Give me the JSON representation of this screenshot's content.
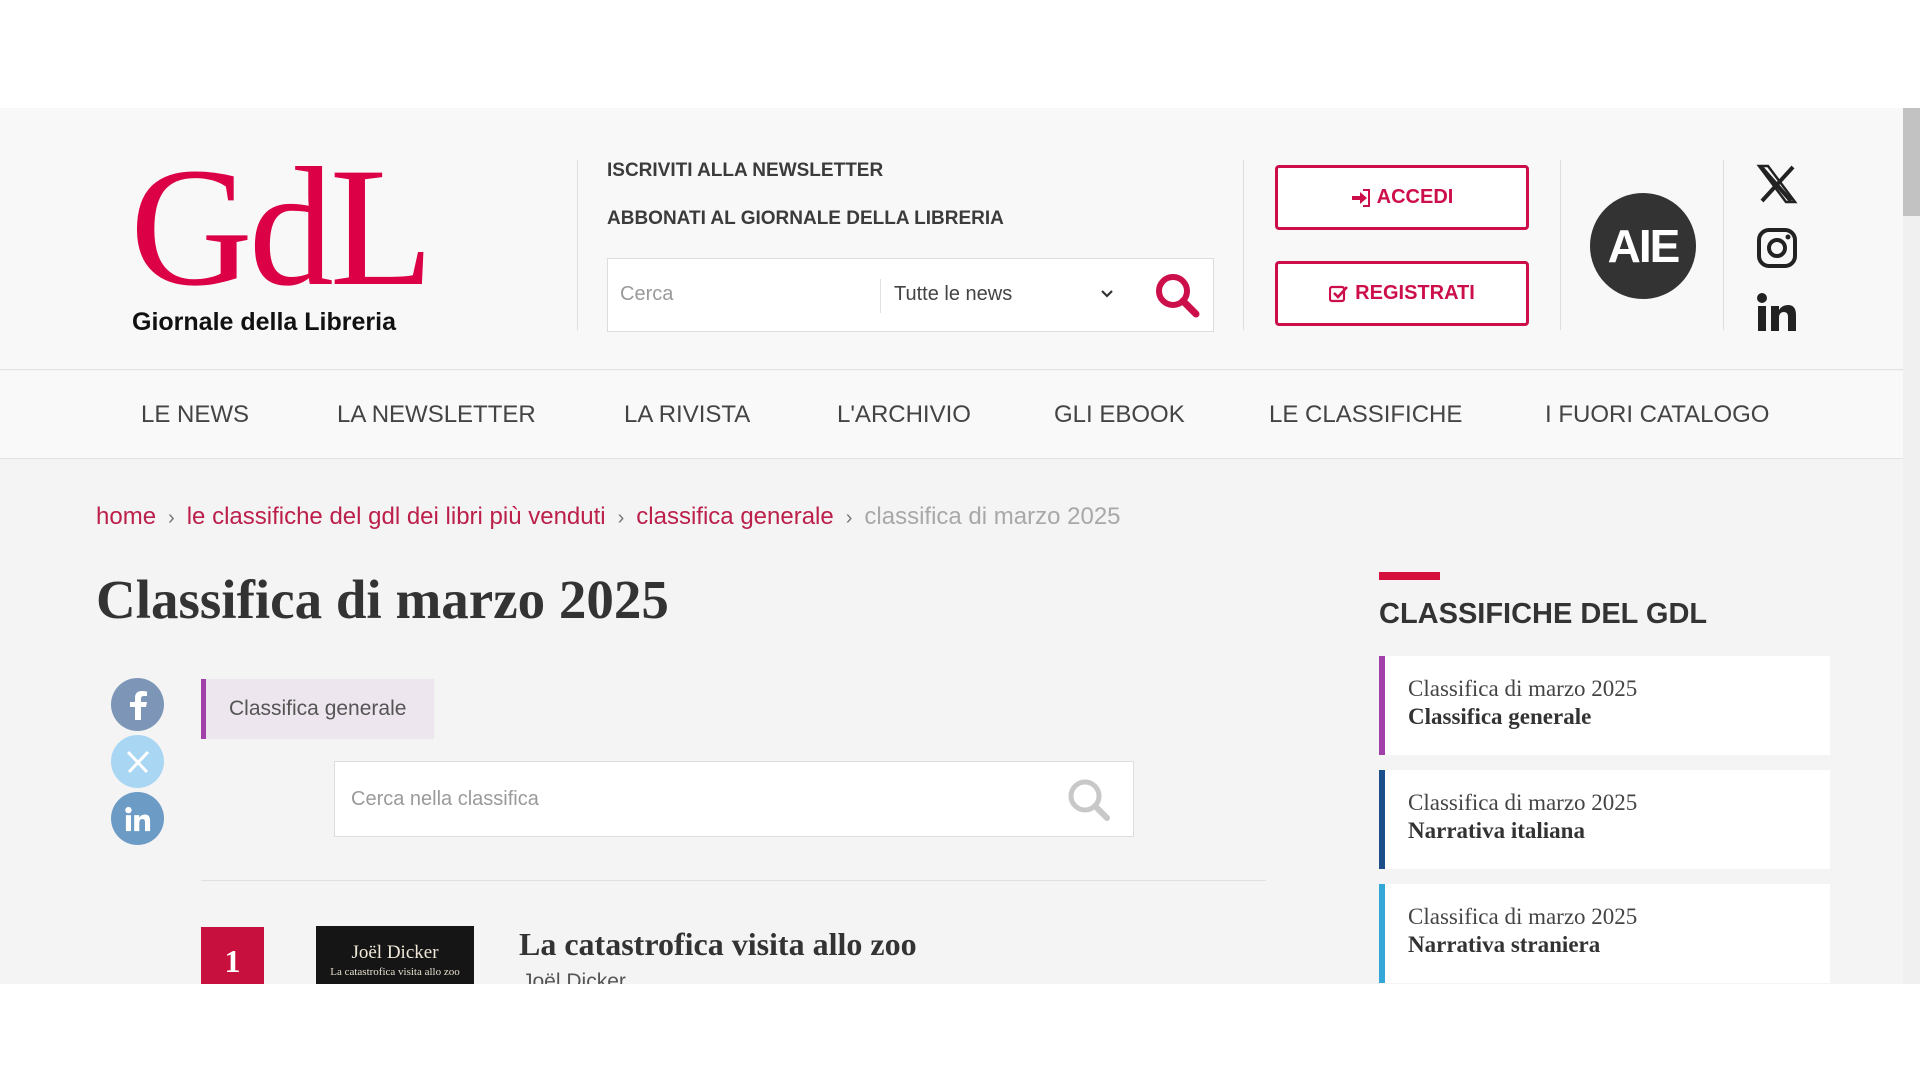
{
  "site": {
    "logo_letters": "GdL",
    "logo_tagline": "Giornale della Libreria",
    "aie_label": "AIE"
  },
  "header": {
    "links": [
      "ISCRIVITI ALLA NEWSLETTER",
      "ABBONATI AL GIORNALE DELLA LIBRERIA"
    ],
    "search": {
      "placeholder": "Cerca",
      "filter_selected": "Tutte le news"
    },
    "accedi_label": "ACCEDI",
    "registrati_label": "REGISTRATI",
    "social": [
      "x-icon",
      "instagram-icon",
      "linkedin-icon"
    ]
  },
  "nav": {
    "items": [
      "LE NEWS",
      "LA NEWSLETTER",
      "LA RIVISTA",
      "L'ARCHIVIO",
      "GLI EBOOK",
      "LE CLASSIFICHE",
      "I FUORI CATALOGO"
    ]
  },
  "breadcrumb": [
    "home",
    "le classifiche del gdl dei libri più venduti",
    "classifica generale",
    "classifica di marzo 2025"
  ],
  "main": {
    "title": "Classifica di marzo 2025",
    "tag": "Classifica generale",
    "ranking_search_placeholder": "Cerca nella classifica",
    "entries": [
      {
        "rank": "1",
        "cover_author": "Joël Dicker",
        "cover_title": "La catastrofica visita allo zoo",
        "title": "La catastrofica visita allo zoo",
        "author": "Joël Dicker"
      }
    ]
  },
  "sidebar": {
    "heading": "CLASSIFICHE DEL GDL",
    "cards": [
      {
        "line1": "Classifica di marzo 2025",
        "line2": "Classifica generale",
        "color": "#a040a8"
      },
      {
        "line1": "Classifica di marzo 2025",
        "line2": "Narrativa italiana",
        "color": "#1a4f8c"
      },
      {
        "line1": "Classifica di marzo 2025",
        "line2": "Narrativa straniera",
        "color": "#33a8d8"
      }
    ]
  },
  "colors": {
    "brand": "#dc0047",
    "link": "#bb1f4a"
  }
}
